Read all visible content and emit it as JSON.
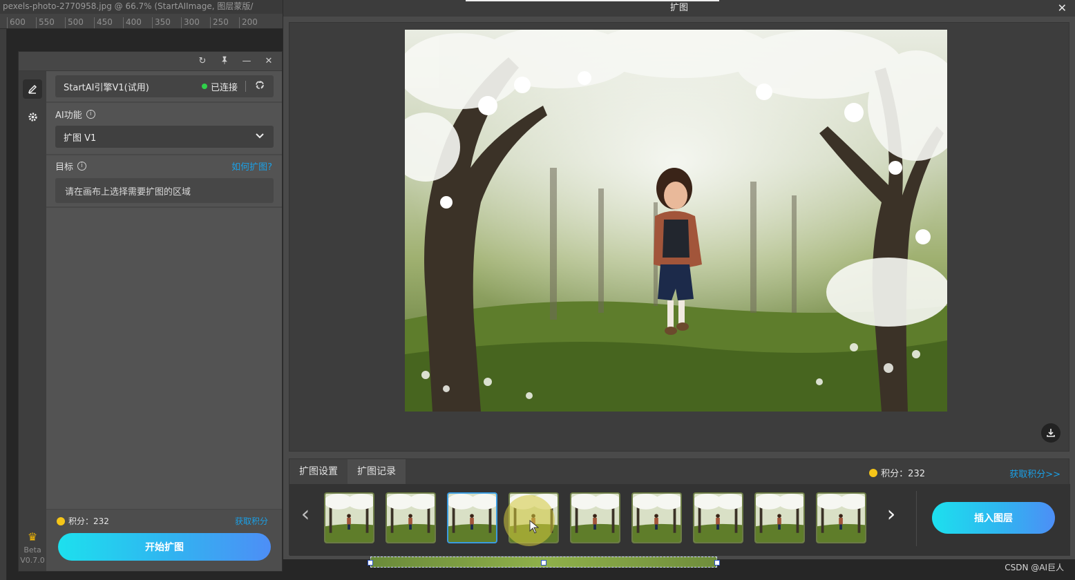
{
  "photoshop": {
    "doc_title": "pexels-photo-2770958.jpg @ 66.7% (StartAIImage, 图层蒙版/",
    "ruler_ticks": [
      "600",
      "550",
      "500",
      "450",
      "400",
      "350",
      "300",
      "250",
      "200"
    ]
  },
  "panel": {
    "controls": {
      "refresh": "↻",
      "pin": "📌",
      "minimize": "—",
      "close": "✕"
    },
    "engine": {
      "name": "StartAI引擎V1(试用)",
      "status": "已连接",
      "status_color": "#2fd14a"
    },
    "ai_function": {
      "label": "AI功能",
      "selected": "扩图 V1"
    },
    "target": {
      "label": "目标",
      "help_link": "如何扩图?",
      "placeholder": "请在画布上选择需要扩图的区域"
    },
    "footer": {
      "points": "积分：232",
      "get_points": "获取积分",
      "start_button": "开始扩图"
    },
    "version": {
      "beta": "Beta",
      "version": "V0.7.0"
    }
  },
  "modal": {
    "title": "扩图",
    "close": "✕",
    "tabs": [
      {
        "label": "扩图设置",
        "active": false
      },
      {
        "label": "扩图记录",
        "active": true
      }
    ],
    "points": "积分：232",
    "get_points": "获取积分>>",
    "insert_button": "插入图层",
    "history": {
      "thumbnails": [
        {
          "name": "history-thumb-1",
          "selected": false
        },
        {
          "name": "history-thumb-2",
          "selected": false
        },
        {
          "name": "history-thumb-3",
          "selected": true
        },
        {
          "name": "history-thumb-4",
          "selected": false
        },
        {
          "name": "history-thumb-5",
          "selected": false
        },
        {
          "name": "history-thumb-6",
          "selected": false
        },
        {
          "name": "history-thumb-7",
          "selected": false
        },
        {
          "name": "history-thumb-8",
          "selected": false
        },
        {
          "name": "history-thumb-9",
          "selected": false
        }
      ]
    }
  },
  "watermark": "CSDN @AI巨人",
  "colors": {
    "accent": "#1ba0e6",
    "button_gradient_start": "#1de0ee",
    "button_gradient_end": "#4d8ef6",
    "coin": "#f5c518"
  }
}
